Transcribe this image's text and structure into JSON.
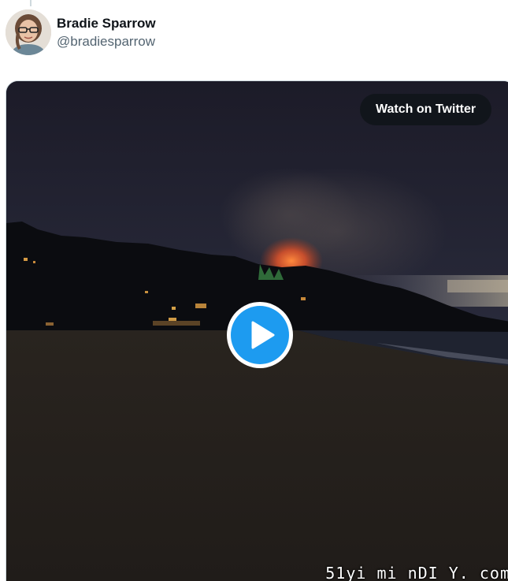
{
  "author": {
    "display_name": "Bradie Sparrow",
    "handle": "@bradiesparrow",
    "avatar_icon": "user-avatar"
  },
  "media": {
    "type": "video",
    "watch_label": "Watch on Twitter",
    "play_icon": "play-icon",
    "accent_color": "#1d9bf0"
  },
  "watermark": {
    "text": "51yi mi nDI Y. com"
  }
}
